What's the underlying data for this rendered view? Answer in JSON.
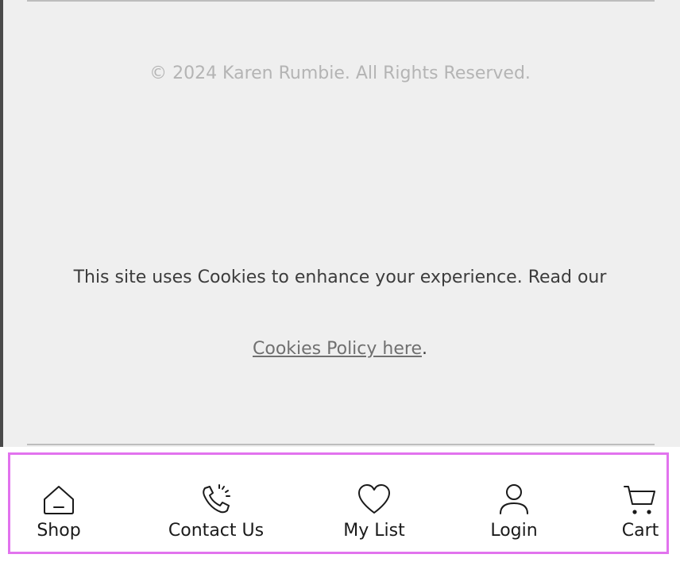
{
  "footer": {
    "copyright": "© 2024 Karen Rumbie. All Rights Reserved.",
    "cookie_notice": "This site uses Cookies to enhance your experience. Read our",
    "cookie_link": "Cookies Policy here",
    "cookie_period": "."
  },
  "bottom_nav": {
    "items": [
      {
        "label": "Shop",
        "icon": "home-icon"
      },
      {
        "label": "Contact Us",
        "icon": "phone-icon"
      },
      {
        "label": "My List",
        "icon": "heart-icon"
      },
      {
        "label": "Login",
        "icon": "user-icon"
      },
      {
        "label": "Cart",
        "icon": "cart-icon"
      }
    ]
  },
  "colors": {
    "background": "#efefef",
    "nav_background": "#ffffff",
    "nav_highlight_border": "#e273ee",
    "copyright_text": "#b4b4b4",
    "body_text": "#3c3c3c",
    "link_text": "#707070"
  }
}
